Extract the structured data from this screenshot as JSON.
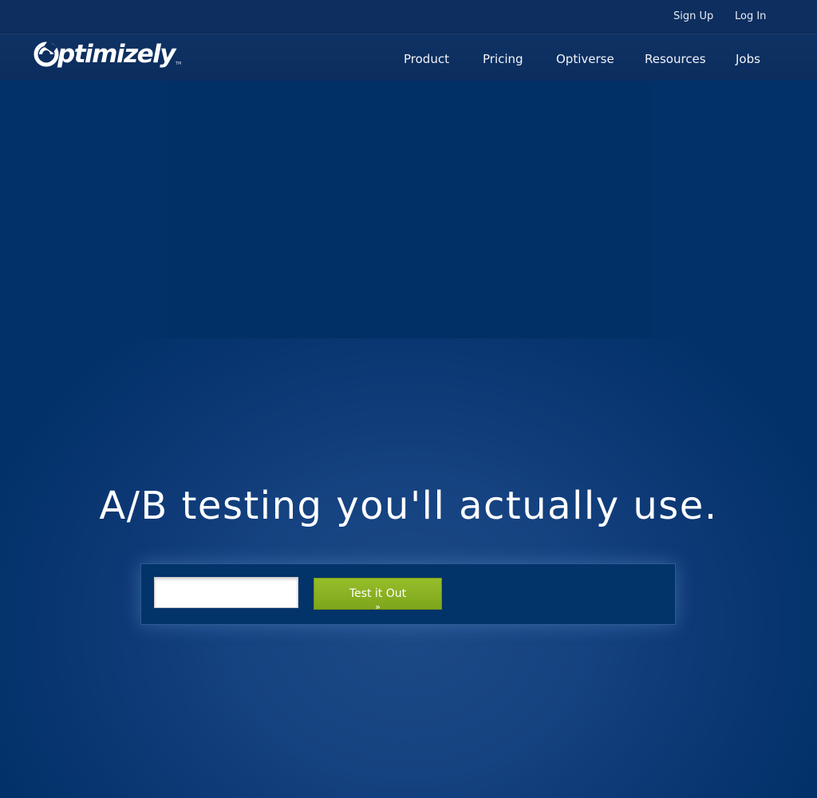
{
  "header": {
    "utility_links": {
      "signup": "Sign Up",
      "login": "Log In"
    },
    "logo": {
      "text": "ptimizely",
      "icon": "optimizely-o-logo-icon",
      "trademark": "TM"
    },
    "nav": [
      {
        "label": "Product"
      },
      {
        "label": "Pricing"
      },
      {
        "label": "Optiverse"
      },
      {
        "label": "Resources"
      },
      {
        "label": "Jobs"
      }
    ]
  },
  "hero": {
    "headline": "A/B testing you'll actually use.",
    "form": {
      "url_value": "",
      "url_placeholder": "",
      "button_label": "Test it Out",
      "button_arrow": "»"
    }
  },
  "colors": {
    "background": "#003169",
    "util_bar": "#0d2e5e",
    "button_green": "#8ab223",
    "text": "#ffffff"
  }
}
